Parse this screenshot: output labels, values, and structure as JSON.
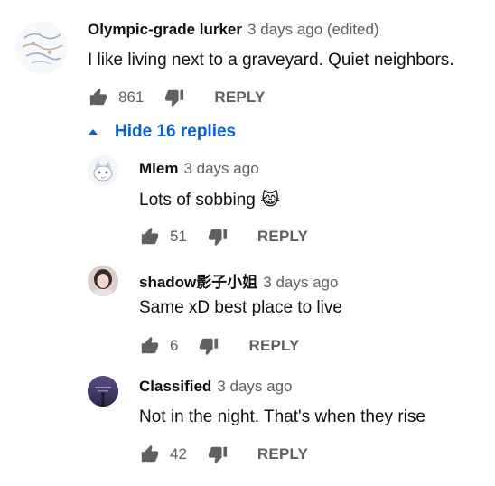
{
  "comment": {
    "author": "Olympic-grade lurker",
    "time": "3 days ago (edited)",
    "text": "I like living next to a graveyard. Quiet neighbors.",
    "likes": "861",
    "reply_label": "REPLY"
  },
  "replies_toggle": {
    "label": "Hide 16 replies",
    "icon": "arrow-up-icon"
  },
  "replies": [
    {
      "author": "Mlem",
      "time": "3 days ago",
      "text": "Lots of sobbing 😹",
      "likes": "51",
      "reply_label": "REPLY"
    },
    {
      "author": "shadow影子小姐",
      "time": "3 days ago",
      "text": "Same xD best place to live",
      "likes": "6",
      "reply_label": "REPLY"
    },
    {
      "author": "Classified",
      "time": "3 days ago",
      "text": "Not in the night. That's when they rise",
      "likes": "42",
      "reply_label": "REPLY"
    }
  ],
  "colors": {
    "link": "#065fd4",
    "secondary_text": "#606060",
    "icon": "#606060"
  }
}
